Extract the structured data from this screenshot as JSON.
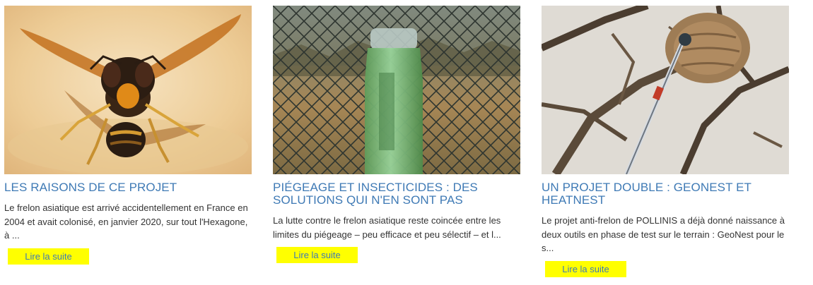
{
  "cards": [
    {
      "title": "LES RAISONS DE CE PROJET",
      "excerpt": "Le frelon asiatique est arrivé accidentellement en France en 2004 et avait colonisé, en janvier 2020, sur tout l'Hexagone, à ...",
      "button": "Lire la suite",
      "image": "asian-hornet-photo"
    },
    {
      "title": "PIÉGEAGE ET INSECTICIDES : DES SOLUTIONS QUI N'EN SONT PAS",
      "excerpt": "La lutte contre le frelon asiatique reste coincée entre les limites du piégeage – peu efficace et peu sélectif – et l...",
      "button": "Lire la suite",
      "image": "bottle-trap-photo"
    },
    {
      "title": "UN PROJET DOUBLE : GEONEST ET HEATNEST",
      "excerpt": "Le projet anti-frelon de POLLINIS a déjà donné naissance à deux outils en phase de test sur le terrain : GeoNest pour le s...",
      "button": "Lire la suite",
      "image": "hornet-nest-photo"
    }
  ],
  "colors": {
    "title": "#3f7ab5",
    "button_bg": "#ffff00",
    "text": "#333333"
  }
}
